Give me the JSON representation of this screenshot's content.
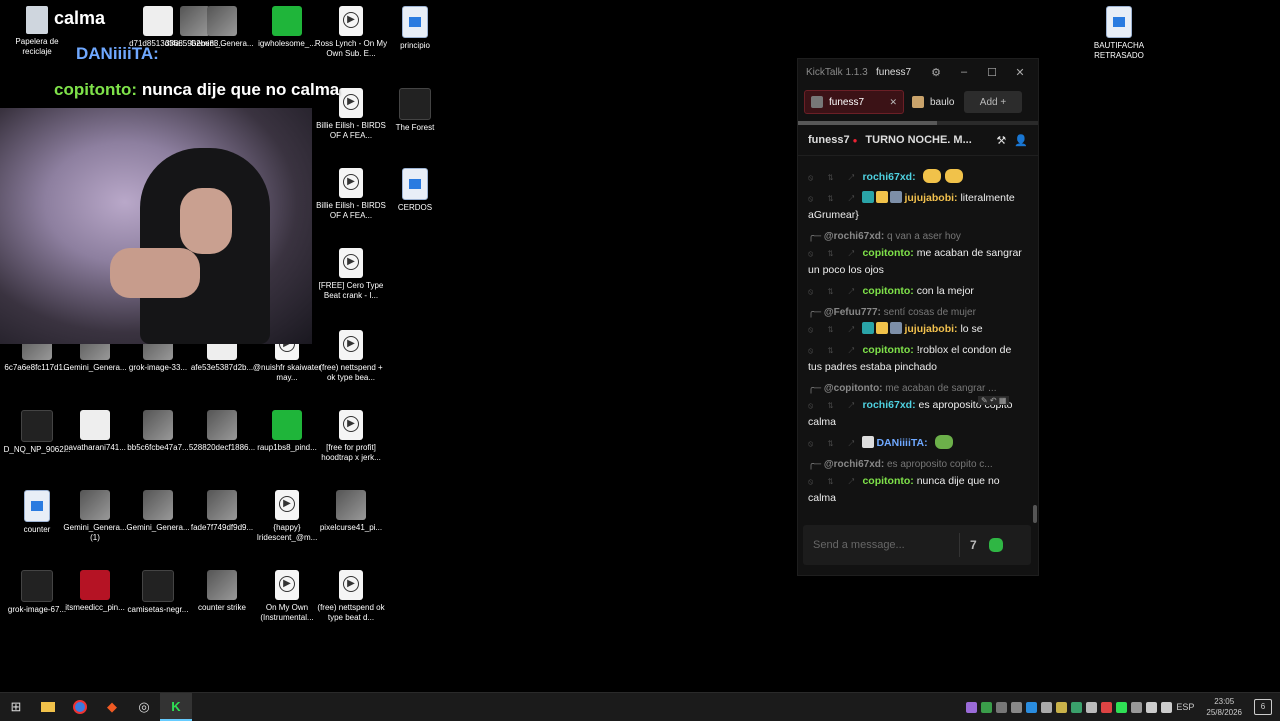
{
  "desktop": {
    "icons": [
      {
        "label": "Papelera de reciclaje",
        "kind": "bin"
      },
      {
        "label": "d71d8513df4a...",
        "kind": "white"
      },
      {
        "label": "336859b2be83...",
        "kind": "img"
      },
      {
        "label": "Gemini_Genera...",
        "kind": "img"
      },
      {
        "label": "igwholesome_...",
        "kind": "green"
      },
      {
        "label": "Ross Lynch - On My Own Sub. E...",
        "kind": "play"
      },
      {
        "label": "principio",
        "kind": "doc"
      },
      {
        "label": "Billie Eilish - BIRDS OF A FEA...",
        "kind": "play"
      },
      {
        "label": "The Forest",
        "kind": "dark"
      },
      {
        "label": "Billie Eilish - BIRDS OF A FEA...",
        "kind": "play"
      },
      {
        "label": "CERDOS",
        "kind": "doc"
      },
      {
        "label": "[FREE] Cero Type Beat  crank  - I...",
        "kind": "play"
      },
      {
        "label": "6c7a6e8fc117d1...",
        "kind": "img"
      },
      {
        "label": "Gemini_Genera...",
        "kind": "img"
      },
      {
        "label": "grok-image-33...",
        "kind": "img"
      },
      {
        "label": "afe53e5387d2b...",
        "kind": "white"
      },
      {
        "label": "@nuishfr skaiwater may...",
        "kind": "play"
      },
      {
        "label": "(free) nettspend + ok type bea...",
        "kind": "play"
      },
      {
        "label": "D_NQ_NP_9062...",
        "kind": "dark"
      },
      {
        "label": "pavatharani741...",
        "kind": "white"
      },
      {
        "label": "bb5c6fcbe47a7...",
        "kind": "img"
      },
      {
        "label": "528820decf1886...",
        "kind": "img"
      },
      {
        "label": "raup1bs8_pind...",
        "kind": "green"
      },
      {
        "label": "[free for profit] hoodtrap x jerk...",
        "kind": "play"
      },
      {
        "label": "counter",
        "kind": "doc"
      },
      {
        "label": "Gemini_Genera... (1)",
        "kind": "img"
      },
      {
        "label": "Gemini_Genera...",
        "kind": "img"
      },
      {
        "label": "fade7f749df9d9...",
        "kind": "img"
      },
      {
        "label": "{happy} Iridescent_@m...",
        "kind": "play"
      },
      {
        "label": "pixelcurse41_pi...",
        "kind": "img"
      },
      {
        "label": "grok-image-67...",
        "kind": "dark"
      },
      {
        "label": "itsmeedicc_pin...",
        "kind": "red"
      },
      {
        "label": "camisetas-negr...",
        "kind": "dark"
      },
      {
        "label": "counter strike",
        "kind": "img"
      },
      {
        "label": "On My Own (Instrumental...",
        "kind": "play"
      },
      {
        "label": "(free) nettspend ok type beat d...",
        "kind": "play"
      },
      {
        "label": "BAUTIFACHA RETRASADO",
        "kind": "doc"
      }
    ]
  },
  "stream_overlay": {
    "line1_user": "calma",
    "line2_user": "DANiiiiTA:",
    "line3_user": "copitonto:",
    "line3_text": "nunca dije que no calma"
  },
  "kicktalk": {
    "app_name": "KickTalk 1.1.3",
    "window_user": "funess7",
    "tabs": [
      {
        "label": "funess7",
        "active": true
      },
      {
        "label": "baulo",
        "active": false
      }
    ],
    "add_label": "Add",
    "chat_load_progress": 0.58,
    "channel_name": "funess7",
    "channel_title": "TURNO NOCHE. M...",
    "messages": [
      {
        "type": "msg",
        "user": "rochi67xd:",
        "color": "#4fd1e0",
        "text": "",
        "emotes": [
          "yellow",
          "yellow"
        ]
      },
      {
        "type": "msg",
        "user": "jujujabobi:",
        "color": "#f2c14e",
        "badges": [
          "#2aa4a8",
          "#f1c24a",
          "#7d8fa8"
        ],
        "text": "literalmente aGrumear}"
      },
      {
        "type": "reply",
        "reply_user": "@rochi67xd:",
        "reply_text": "q van a aser hoy"
      },
      {
        "type": "msg",
        "user": "copitonto:",
        "color": "#7fe24a",
        "text": "me acaban de sangrar un poco los ojos"
      },
      {
        "type": "msg",
        "user": "copitonto:",
        "color": "#7fe24a",
        "text": "con la mejor"
      },
      {
        "type": "reply",
        "reply_user": "@Fefuu777:",
        "reply_text": "sentí cosas de mujer"
      },
      {
        "type": "msg",
        "user": "jujujabobi:",
        "color": "#f2c14e",
        "badges": [
          "#2aa4a8",
          "#f1c24a",
          "#7d8fa8"
        ],
        "text": "lo se"
      },
      {
        "type": "msg",
        "user": "copitonto:",
        "color": "#7fe24a",
        "text": "!roblox el condon de tus padres estaba pinchado"
      },
      {
        "type": "reply",
        "reply_user": "@copitonto:",
        "reply_text": "me acaban de sangrar ..."
      },
      {
        "type": "msg",
        "user": "rochi67xd:",
        "color": "#4fd1e0",
        "text": "es aproposito copito calma"
      },
      {
        "type": "msg",
        "user": "DANiiiiTA:",
        "color": "#6fa8ff",
        "badges": [
          "#ddd"
        ],
        "text": "",
        "emotes": [
          "green"
        ]
      },
      {
        "type": "reply",
        "reply_user": "@rochi67xd:",
        "reply_text": "es aproposito copito c..."
      },
      {
        "type": "msg",
        "user": "copitonto:",
        "color": "#7fe24a",
        "text": "nunca dije que no calma"
      }
    ],
    "input_placeholder": "Send a message..."
  },
  "taskbar": {
    "language": "ESP",
    "time": "23:05",
    "date": "25/8/2026",
    "notifications": "6"
  }
}
